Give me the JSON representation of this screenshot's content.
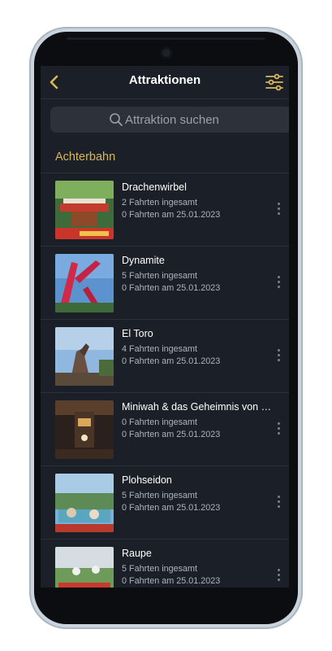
{
  "appbar": {
    "title": "Attraktionen"
  },
  "search": {
    "placeholder": "Attraktion suchen"
  },
  "section": {
    "title": "Achterbahn"
  },
  "items": [
    {
      "name": "Drachenwirbel",
      "total": "2 Fahrten ingesamt",
      "today": "0 Fahrten am 25.01.2023"
    },
    {
      "name": "Dynamite",
      "total": "5 Fahrten ingesamt",
      "today": "0 Fahrten am 25.01.2023"
    },
    {
      "name": "El Toro",
      "total": "4 Fahrten ingesamt",
      "today": "0 Fahrten am 25.01.2023"
    },
    {
      "name": "Miniwah & das Geheimnis von G...",
      "total": "0 Fahrten ingesamt",
      "today": "0 Fahrten am 25.01.2023"
    },
    {
      "name": "Plohseidon",
      "total": "5 Fahrten ingesamt",
      "today": "0 Fahrten am 25.01.2023"
    },
    {
      "name": "Raupe",
      "total": "5 Fahrten ingesamt",
      "today": "0 Fahrten am 25.01.2023"
    }
  ],
  "colors": {
    "accent": "#d8b75a",
    "background": "#1b1f27",
    "search_bg": "#2c313a"
  }
}
